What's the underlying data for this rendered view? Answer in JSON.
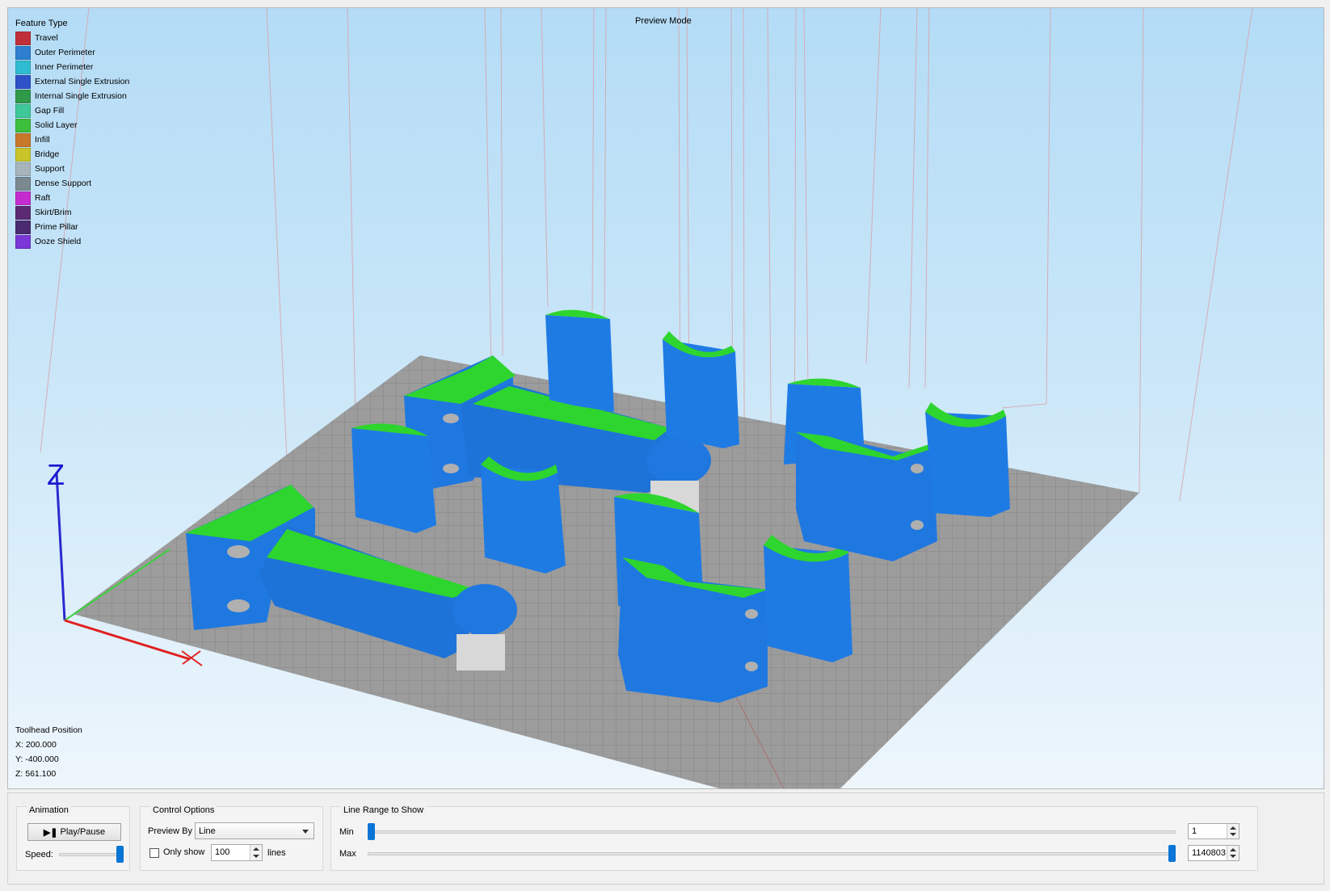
{
  "viewport": {
    "legend_title": "Feature Type",
    "preview_mode_label": "Preview Mode",
    "legend": [
      {
        "label": "Travel",
        "color": "#c0303a"
      },
      {
        "label": "Outer Perimeter",
        "color": "#2e7fd0"
      },
      {
        "label": "Inner Perimeter",
        "color": "#2fbcd0"
      },
      {
        "label": "External Single Extrusion",
        "color": "#2f52c8"
      },
      {
        "label": "Internal Single Extrusion",
        "color": "#2f9a4a"
      },
      {
        "label": "Gap Fill",
        "color": "#3fc898"
      },
      {
        "label": "Solid Layer",
        "color": "#3cbf3c"
      },
      {
        "label": "Infill",
        "color": "#c8782a"
      },
      {
        "label": "Bridge",
        "color": "#c8c42a"
      },
      {
        "label": "Support",
        "color": "#a8b4bc"
      },
      {
        "label": "Dense Support",
        "color": "#7a8890"
      },
      {
        "label": "Raft",
        "color": "#c52ccf"
      },
      {
        "label": "Skirt/Brim",
        "color": "#5b2a72"
      },
      {
        "label": "Prime Pillar",
        "color": "#4a2a70"
      },
      {
        "label": "Ooze Shield",
        "color": "#7a36d6"
      }
    ],
    "axis_labels": {
      "z": "Z",
      "x": "X"
    },
    "toolhead": {
      "title": "Toolhead Position",
      "x": "X: 200.000",
      "y": "Y: -400.000",
      "z": "Z: 561.100"
    }
  },
  "controls": {
    "animation": {
      "title": "Animation",
      "play_pause_label": "Play/Pause",
      "speed_label": "Speed:",
      "speed_value": 1.0
    },
    "control_options": {
      "title": "Control Options",
      "preview_by_label": "Preview By",
      "preview_by_value": "Line",
      "only_show_label": "Only show",
      "only_show_checked": false,
      "only_show_value": "100",
      "lines_label": "lines"
    },
    "line_range": {
      "title": "Line Range to Show",
      "min_label": "Min",
      "min_value": "1",
      "min_fraction": 0.0,
      "max_label": "Max",
      "max_value": "1140803",
      "max_fraction": 1.0
    }
  }
}
